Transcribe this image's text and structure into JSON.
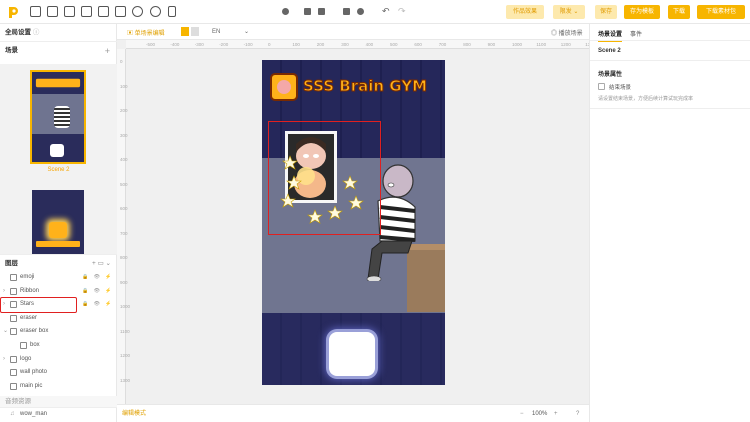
{
  "toolbar": {
    "works_effect": "作品效果",
    "publish": "限发",
    "save": "保存",
    "save_as_template": "存为模板",
    "download": "下载",
    "download_copy": "下载素材包"
  },
  "left": {
    "global_settings": "全局设置",
    "scenes_title": "场景",
    "scene2_label": "Scene 2",
    "layers_title": "图层",
    "audio_title": "音频资源",
    "layers": [
      {
        "name": "emoji",
        "icon": "image-icon",
        "arrow": ""
      },
      {
        "name": "Ribbon",
        "icon": "effect-icon",
        "arrow": "›"
      },
      {
        "name": "Stars",
        "icon": "effect-icon",
        "arrow": "›"
      },
      {
        "name": "eraser",
        "icon": "image-icon",
        "arrow": ""
      },
      {
        "name": "eraser box",
        "icon": "folder-icon",
        "arrow": "⌄"
      },
      {
        "name": "box",
        "icon": "image-icon",
        "arrow": ""
      },
      {
        "name": "logo",
        "icon": "folder-icon",
        "arrow": "›"
      },
      {
        "name": "wall photo",
        "icon": "image-icon",
        "arrow": ""
      },
      {
        "name": "main pic",
        "icon": "image-icon",
        "arrow": ""
      }
    ],
    "audio_item": "wow_man"
  },
  "canvas": {
    "single_scene_btn": "单场景编辑",
    "lang": "EN",
    "play_scene": "播放场景",
    "footer_left": "编辑模式",
    "zoom": "100%",
    "ruler_h": [
      "-500",
      "-400",
      "-300",
      "-200",
      "-100",
      "0",
      "100",
      "200",
      "300",
      "400",
      "500",
      "600",
      "700",
      "800",
      "900",
      "1000",
      "1100",
      "1200",
      "130"
    ],
    "ruler_v": [
      "0",
      "100",
      "200",
      "300",
      "400",
      "500",
      "600",
      "700",
      "800",
      "900",
      "1000",
      "1100",
      "1200",
      "1300"
    ]
  },
  "stage": {
    "title": "SSS Brain GYM"
  },
  "right": {
    "tab_scene": "场景设置",
    "tab_event": "事件",
    "scene_name": "Scene 2",
    "props_title": "场景属性",
    "end_scene": "结束场景",
    "hint": "请设置结束场景，方便后续计算试玩完成率"
  },
  "colors": {
    "accent": "#f7b500",
    "highlight": "#e02020",
    "stage_bg": "#2b2d60"
  }
}
